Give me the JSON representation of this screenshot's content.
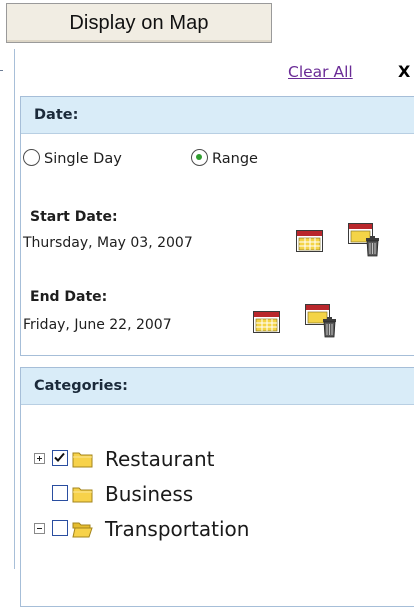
{
  "toolbar": {
    "display_button": "Display on Map"
  },
  "panel": {
    "clear_all": "Clear All",
    "close": "X"
  },
  "date": {
    "heading": "Date:",
    "modes": [
      {
        "label": "Single Day",
        "selected": false
      },
      {
        "label": "Range",
        "selected": true
      }
    ],
    "start_label": "Start Date:",
    "start_value": "Thursday, May 03, 2007",
    "end_label": "End Date:",
    "end_value": "Friday, June 22, 2007"
  },
  "categories": {
    "heading": "Categories:",
    "items": [
      {
        "label": "Restaurant",
        "checked": true,
        "expander": "plus"
      },
      {
        "label": "Business",
        "checked": false,
        "expander": "none"
      },
      {
        "label": "Transportation",
        "checked": false,
        "expander": "minus"
      }
    ]
  },
  "colors": {
    "section_header_bg": "#d9ecf8",
    "section_border": "#a6bed8",
    "link": "#6a2b96",
    "radio_dot": "#2f9d2f",
    "checkbox_border": "#2a4ea0",
    "folder_fill": "#f7d24a",
    "button_bg": "#f1ede3"
  },
  "icons": {
    "calendar": "calendar-icon",
    "clear_date": "calendar-trash-icon",
    "folder": "folder-icon",
    "folder_open": "folder-open-icon"
  }
}
